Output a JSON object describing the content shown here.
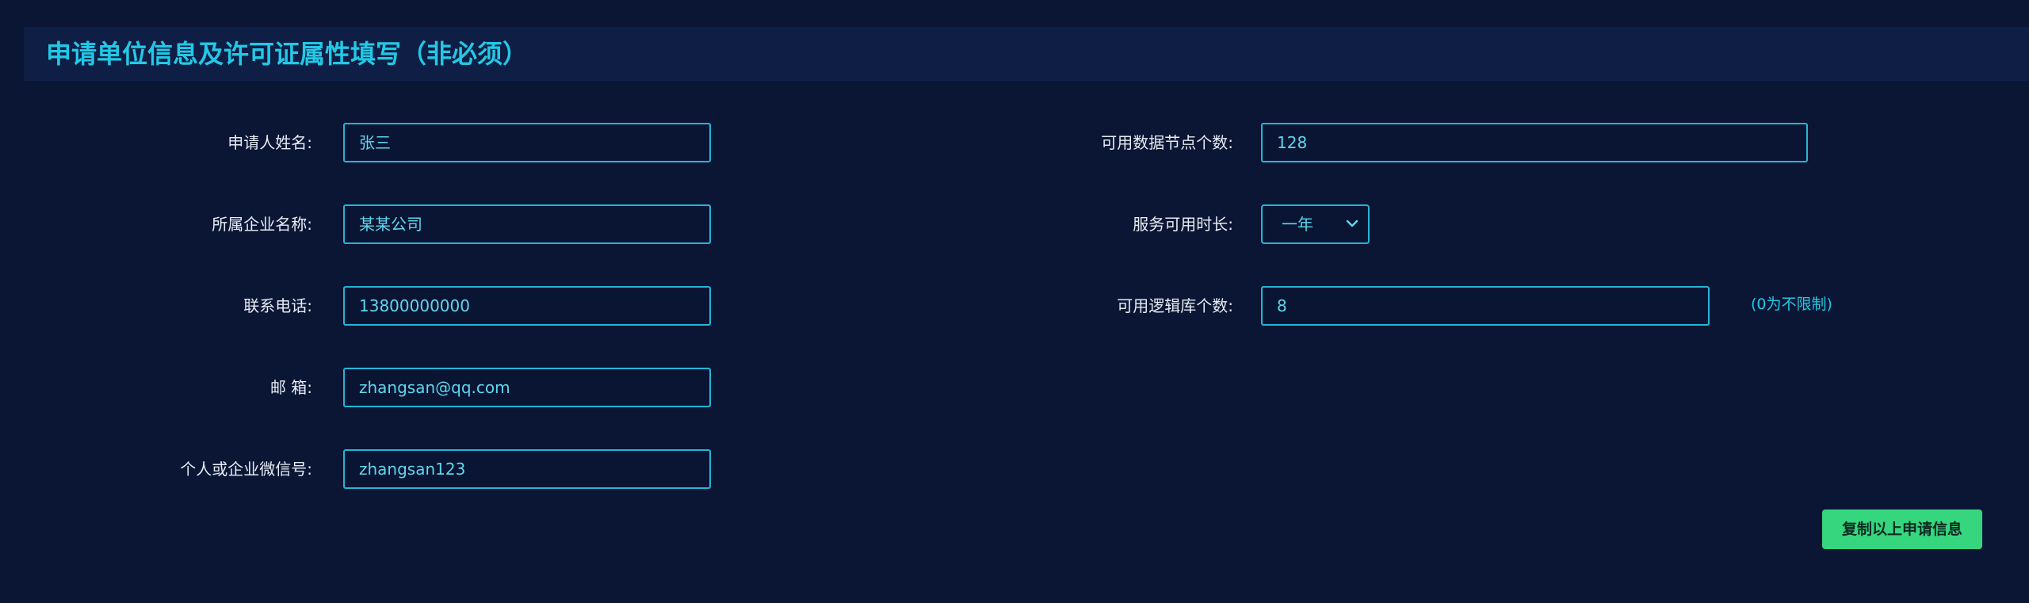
{
  "header": {
    "title": "申请单位信息及许可证属性填写（非必须）"
  },
  "left_form": {
    "applicant_name": {
      "label": "申请人姓名:",
      "value": "张三"
    },
    "company_name": {
      "label": "所属企业名称:",
      "value": "某某公司"
    },
    "phone": {
      "label": "联系电话:",
      "value": "13800000000"
    },
    "email": {
      "label": "邮 箱:",
      "value": "zhangsan@qq.com"
    },
    "wechat": {
      "label": "个人或企业微信号:",
      "value": "zhangsan123"
    }
  },
  "right_form": {
    "data_nodes": {
      "label": "可用数据节点个数:",
      "value": "128"
    },
    "service_duration": {
      "label": "服务可用时长:",
      "value": "一年"
    },
    "logical_dbs": {
      "label": "可用逻辑库个数:",
      "value": "8",
      "hint": "(0为不限制)"
    }
  },
  "actions": {
    "copy_label": "复制以上申请信息"
  },
  "colors": {
    "background": "#0b1634",
    "header_bg": "#0e1e45",
    "accent": "#23c8e6",
    "input_border": "#23b6d6",
    "button": "#35d67e"
  },
  "icons": {
    "select_arrow": "chevron-down-icon"
  }
}
